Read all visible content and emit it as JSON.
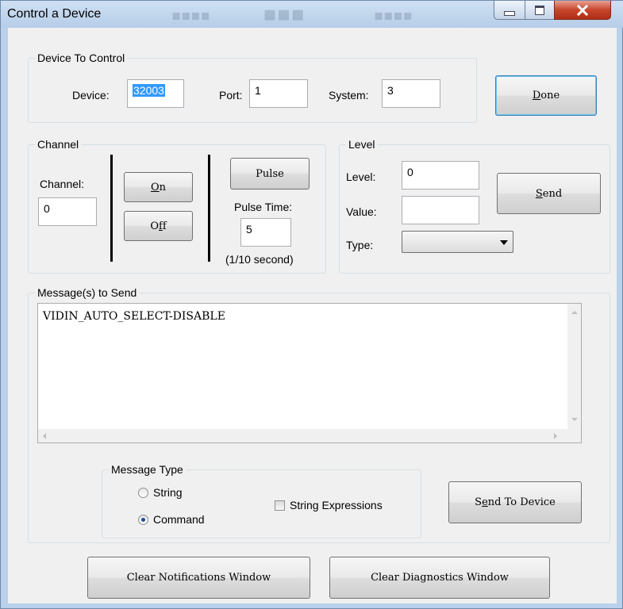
{
  "window": {
    "title": "Control a Device"
  },
  "device_group": {
    "legend": "Device To Control",
    "device_label": "Device:",
    "device_value": "32003",
    "port_label": "Port:",
    "port_value": "1",
    "system_label": "System:",
    "system_value": "3"
  },
  "done_button": {
    "label": "Done",
    "mnemonic": "D",
    "rest": "one"
  },
  "channel_group": {
    "legend": "Channel",
    "channel_label": "Channel:",
    "channel_value": "0",
    "on_button": {
      "mnemonic": "O",
      "rest": "n"
    },
    "off_button": {
      "pre": "O",
      "mnemonic": "f",
      "rest": "f"
    },
    "pulse_button": "Pulse",
    "pulse_time_label": "Pulse Time:",
    "pulse_time_value": "5",
    "pulse_unit": "(1/10 second)"
  },
  "level_group": {
    "legend": "Level",
    "level_label": "Level:",
    "level_value": "0",
    "value_label": "Value:",
    "value_value": "",
    "type_label": "Type:",
    "type_value": "",
    "send_button": {
      "mnemonic": "S",
      "rest": "end"
    }
  },
  "message_group": {
    "legend": "Message(s) to Send",
    "message_text": "VIDIN_AUTO_SELECT-DISABLE"
  },
  "message_type": {
    "legend": "Message Type",
    "string_label": "String",
    "command_label": "Command",
    "selected": "Command",
    "string_expressions_label": "String Expressions",
    "string_expressions_checked": false
  },
  "send_to_device_button": {
    "pre": "S",
    "mnemonic": "e",
    "rest": "nd To Device"
  },
  "clear_notifications_button": "Clear Notifications Window",
  "clear_diagnostics_button": "Clear Diagnostics Window",
  "icons": [
    "minimize-icon",
    "maximize-icon",
    "close-icon",
    "chevron-down-icon",
    "scroll-up-arrow-icon",
    "scroll-down-arrow-icon",
    "scroll-left-arrow-icon",
    "scroll-right-arrow-icon"
  ]
}
